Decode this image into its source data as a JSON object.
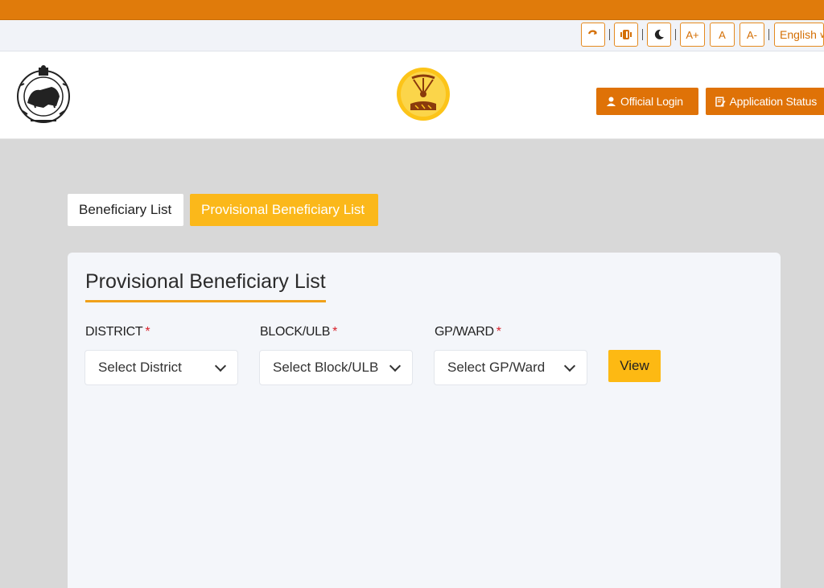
{
  "accessibility": {
    "reset_icon": "refresh-icon",
    "contrast_icon": "contrast-icon",
    "dark_mode_icon": "moon-icon",
    "font_increase": "A+",
    "font_normal": "A",
    "font_decrease": "A-",
    "language": "English"
  },
  "header": {
    "official_login": "Official Login",
    "application_status": "Application Status"
  },
  "tabs": [
    {
      "label": "Beneficiary List",
      "active": false
    },
    {
      "label": "Provisional Beneficiary List",
      "active": true
    }
  ],
  "card": {
    "title": "Provisional Beneficiary List",
    "fields": [
      {
        "label": "DISTRICT",
        "required_mark": "*",
        "placeholder": "Select District"
      },
      {
        "label": "BLOCK/ULB",
        "required_mark": "*",
        "placeholder": "Select Block/ULB"
      },
      {
        "label": "GP/WARD",
        "required_mark": "*",
        "placeholder": "Select GP/Ward"
      }
    ],
    "view_button": "View"
  },
  "colors": {
    "accent_orange": "#df7207",
    "accent_yellow": "#fbb81a",
    "required": "#d9232d"
  }
}
